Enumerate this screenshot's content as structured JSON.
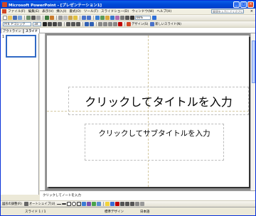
{
  "window": {
    "title": "Microsoft PowerPoint - [プレゼンテーション1]",
    "controls": [
      "_",
      "□",
      "×"
    ]
  },
  "menubar": {
    "items": [
      "ファイル(F)",
      "編集(E)",
      "表示(V)",
      "挿入(I)",
      "書式(O)",
      "ツール(T)",
      "スライドショー(D)",
      "ウィンドウ(W)",
      "ヘルプ(H)"
    ],
    "help_placeholder": "質問を入力してください",
    "close": "×"
  },
  "toolbar_standard": {
    "zoom": "66%"
  },
  "toolbar_format": {
    "font_name": "ＭＳ Ｐゴシック",
    "font_size": "18",
    "design_label": "デザイン(S)",
    "new_slide_label": "新しいスライド(N)"
  },
  "left_pane": {
    "tabs": [
      "アウトライン",
      "スライド"
    ],
    "close": "×",
    "slide_number": "1"
  },
  "slide": {
    "title_placeholder": "クリックしてタイトルを入力",
    "subtitle_placeholder": "クリックしてサブタイトルを入力"
  },
  "notes": {
    "placeholder": "クリックしてノートを入力"
  },
  "drawing_toolbar": {
    "draw_label": "図形の調整(R)",
    "autoshape_label": "オートシェイプ(U)"
  },
  "statusbar": {
    "slide_info": "スライド 1 / 1",
    "design": "標準デザイン",
    "language": "日本語"
  },
  "colors": {
    "titlebar": "#0a5fe8",
    "app_accent": "#d24726",
    "workspace": "#8c8c8c",
    "selection": "#316ac5"
  }
}
